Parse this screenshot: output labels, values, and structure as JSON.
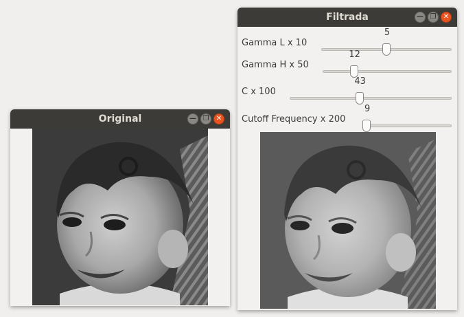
{
  "windows": {
    "original": {
      "title": "Original",
      "buttons": {
        "minimize": "—",
        "maximize": "❐",
        "close": "✕"
      }
    },
    "filtrada": {
      "title": "Filtrada",
      "buttons": {
        "minimize": "—",
        "maximize": "❐",
        "close": "✕"
      },
      "sliders": [
        {
          "label": "Gamma L x 10",
          "value": "5",
          "fraction": 0.5
        },
        {
          "label": "Gamma H x 50",
          "value": "12",
          "fraction": 0.24
        },
        {
          "label": "C x 100",
          "value": "43",
          "fraction": 0.43
        },
        {
          "label": "Cutoff Frequency x 200",
          "value": "9",
          "fraction": 0.04
        }
      ]
    }
  },
  "colors": {
    "titlebar": "#3c3b37",
    "close_button": "#e95420",
    "window_bg": "#f2f1f0"
  }
}
